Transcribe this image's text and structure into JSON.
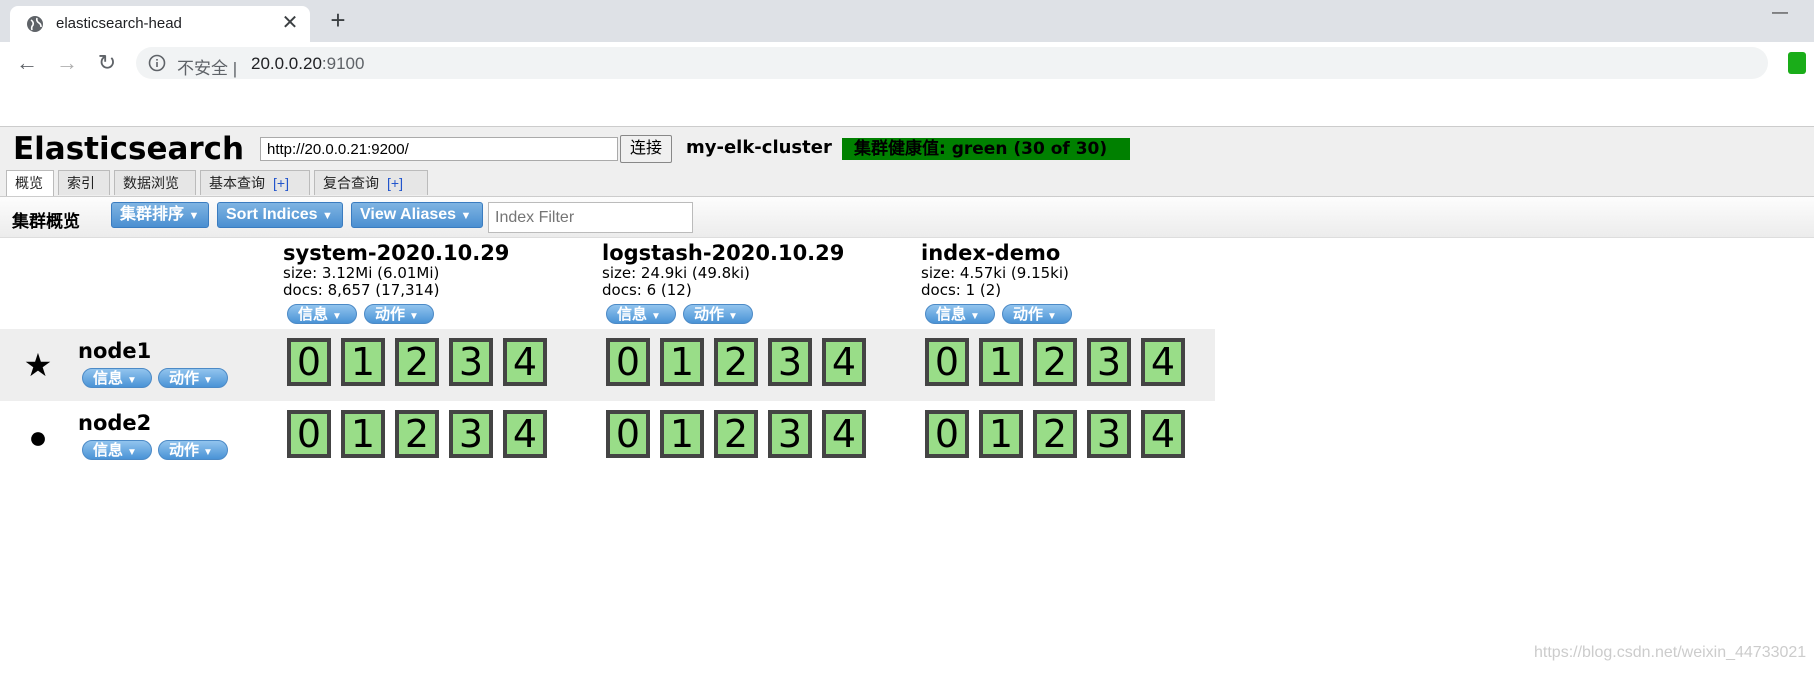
{
  "browser": {
    "tab_title": "elasticsearch-head",
    "insecure_label": "不安全",
    "url_host": "20.0.0.20",
    "url_port": ":9100"
  },
  "app": {
    "title": "Elasticsearch",
    "connect_url": "http://20.0.0.21:9200/",
    "connect_button": "连接",
    "cluster_name": "my-elk-cluster",
    "health_text": "集群健康值: green (30 of 30)",
    "health_color": "#008000",
    "tabs": [
      {
        "label": "概览",
        "plus": ""
      },
      {
        "label": "索引",
        "plus": ""
      },
      {
        "label": "数据浏览",
        "plus": ""
      },
      {
        "label": "基本查询",
        "plus": "[+]"
      },
      {
        "label": "复合查询",
        "plus": "[+]"
      }
    ]
  },
  "overview": {
    "title": "集群概览",
    "sort_cluster_button": "集群排序",
    "sort_indices_button": "Sort Indices",
    "view_aliases_button": "View Aliases",
    "index_filter_placeholder": "Index Filter",
    "info_label": "信息",
    "action_label": "动作"
  },
  "indices": [
    {
      "name": "system-2020.10.29",
      "size": "size: 3.12Mi (6.01Mi)",
      "docs": "docs: 8,657 (17,314)"
    },
    {
      "name": "logstash-2020.10.29",
      "size": "size: 24.9ki (49.8ki)",
      "docs": "docs: 6 (12)"
    },
    {
      "name": "index-demo",
      "size": "size: 4.57ki (9.15ki)",
      "docs": "docs: 1 (2)"
    }
  ],
  "nodes": [
    {
      "name": "node1",
      "marker": "★",
      "role": "master"
    },
    {
      "name": "node2",
      "marker": "●",
      "role": "data"
    }
  ],
  "shards": [
    "0",
    "1",
    "2",
    "3",
    "4"
  ],
  "shard_color": "#99dd88",
  "watermark": "https://blog.csdn.net/weixin_44733021"
}
